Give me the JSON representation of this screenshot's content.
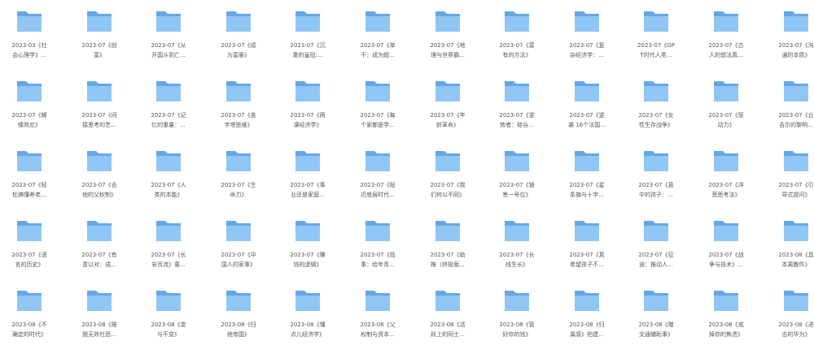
{
  "folder_icon": "folder-icon",
  "colors": {
    "folder_back": "#65a7e6",
    "folder_front": "#90c6f3",
    "label": "#555555"
  },
  "rows": [
    [
      "2023-03《社\n会心理学》...",
      "2023-07《创\n富》",
      "2023-07《从\n开国斗到亡...",
      "2023-07《成\n为富豪》",
      "2023-07《沉\n重的皇冠:...",
      "2023-07《单\n干：成为超...",
      "2023-07《地\n理与世界霸...",
      "2023-07《富\n有的方法》",
      "2023-07《复\n杂经济学：...",
      "2023-07《GP\nT时代人类...",
      "2023-07《古\n人的想法真...",
      "2023-07《沟\n通的本质》"
    ],
    [
      "2023-07《蝴\n蝶效应》",
      "2023-07《间\n接思考的艺...",
      "2023-07《记\n忆的重量：...",
      "2023-07《金\n字塔思维》",
      "2023-07《两\n课经济学》",
      "2023-07《每\n个家都是学...",
      "2023-07《年\n龄革命》",
      "2023-07《逆\n势者：硅谷...",
      "2023-07《逆\n袭 16个法国...",
      "2023-07《女\n性生存战争》",
      "2023-07《驱\n动力》",
      "2023-07《丘\n吉尔的黎明..."
    ],
    [
      "2023-07《轻\n松搞懂养老...",
      "2023-07《去\n他的父权制》",
      "2023-07《人\n类的本能》",
      "2023-07《生\n命力》",
      "2023-07《事\n业还是家庭...",
      "2023-07《贴\n近底层时代...",
      "2023-07《我\n们何以不同》",
      "2023-07《销\n售一号位》",
      "2023-07《星\n条旗与十字...",
      "2023-07《县\n中的孩子：...",
      "2023-07《洋\n葱思考法》",
      "2023-07《引\n导式提问》"
    ],
    [
      "2023-07《语\n言的历史》",
      "2023-07《有\n意以对：成...",
      "2023-07《长\n安页流》童...",
      "2023-07《中\n国人的家事》",
      "2023-07《赚\n钱的逻辑》",
      "2023-07《找\n事：给年青...",
      "2023-07《助\n推（终极版...",
      "2023-07《长\n线生长》",
      "2023-07《真\n希望孩子不...",
      "2023-07《征\n途：推动人...",
      "2023-07《战\n争与技术》...",
      "2023-08《具\n本离散件》"
    ],
    [
      "2023-08《不\n确定的时代》",
      "2023-08《摆\n脱无效社恐...",
      "2023-08《变\n与不变》",
      "2023-08《归\n统帝国》",
      "2023-08《懂\n点儿经济学》",
      "2023-08《父\n权制与资本...",
      "2023-08《活\n跃上的同士...",
      "2023-08《管\n好你的钱》",
      "2023-08《归\n属感》拍建...",
      "2023-08《赠\n交通辅助事》",
      "2023-08《戒\n掉你的焦虑》",
      "2023-08《进\n击的华为》"
    ]
  ]
}
